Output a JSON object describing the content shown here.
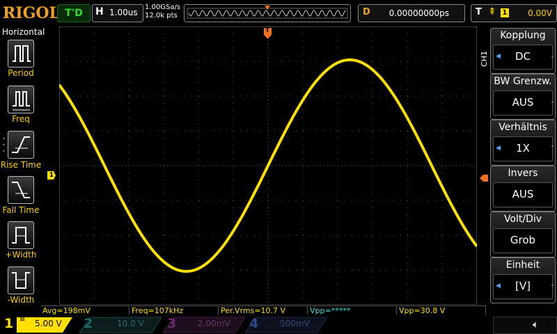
{
  "header": {
    "logo": "RIGOL",
    "trigger_state": "T'D",
    "horizontal_key": "H",
    "timebase": "1.00us",
    "sample_rate": "1.00GSa/s",
    "memory_depth": "12.0k pts",
    "delay_key": "D",
    "delay_value": "0.00000000ps",
    "trigger_key": "T",
    "trigger_slope_icon": "rising-edge-icon",
    "trigger_source": "1",
    "trigger_level": "0.00V"
  },
  "left_menu": {
    "title": "Horizontal",
    "items": [
      {
        "label": "Period",
        "icon": "period-icon"
      },
      {
        "label": "Freq",
        "icon": "frequency-icon"
      },
      {
        "label": "Rise Time",
        "icon": "rise-time-icon"
      },
      {
        "label": "Fall Time",
        "icon": "fall-time-icon"
      },
      {
        "label": "+Width",
        "icon": "positive-width-icon"
      },
      {
        "label": "-Width",
        "icon": "negative-width-icon"
      }
    ]
  },
  "markers": {
    "channel1": "1",
    "trigger_pos": "T"
  },
  "right_menu": {
    "channel_label": "CH1",
    "items": [
      {
        "title": "Kopplung",
        "value": "DC"
      },
      {
        "title": "BW Grenzw.",
        "value": "AUS"
      },
      {
        "title": "Verhältnis",
        "value": "1X"
      },
      {
        "title": "Invers",
        "value": "AUS"
      },
      {
        "title": "Volt/Div",
        "value": "Grob"
      },
      {
        "title": "Einheit",
        "value": "[V]"
      }
    ]
  },
  "measurements": [
    "Avg=198mV",
    "Freq=107kHz",
    "Per.Vrms=10.7 V",
    "Vpp=*****",
    "Vpp=30.8 V"
  ],
  "channels": [
    {
      "num": "1",
      "scale": "5.00 V",
      "color": "#ffe000",
      "active": true
    },
    {
      "num": "2",
      "scale": "10.0 V",
      "color": "#1a6a6a",
      "active": false
    },
    {
      "num": "3",
      "scale": "2.00mV",
      "color": "#6a2a6a",
      "active": false
    },
    {
      "num": "4",
      "scale": "500mV",
      "color": "#1a3a6a",
      "active": false
    }
  ],
  "colors": {
    "trace": "#ffe000",
    "accent": "#f0a020",
    "menu_label": "#ffd000"
  }
}
